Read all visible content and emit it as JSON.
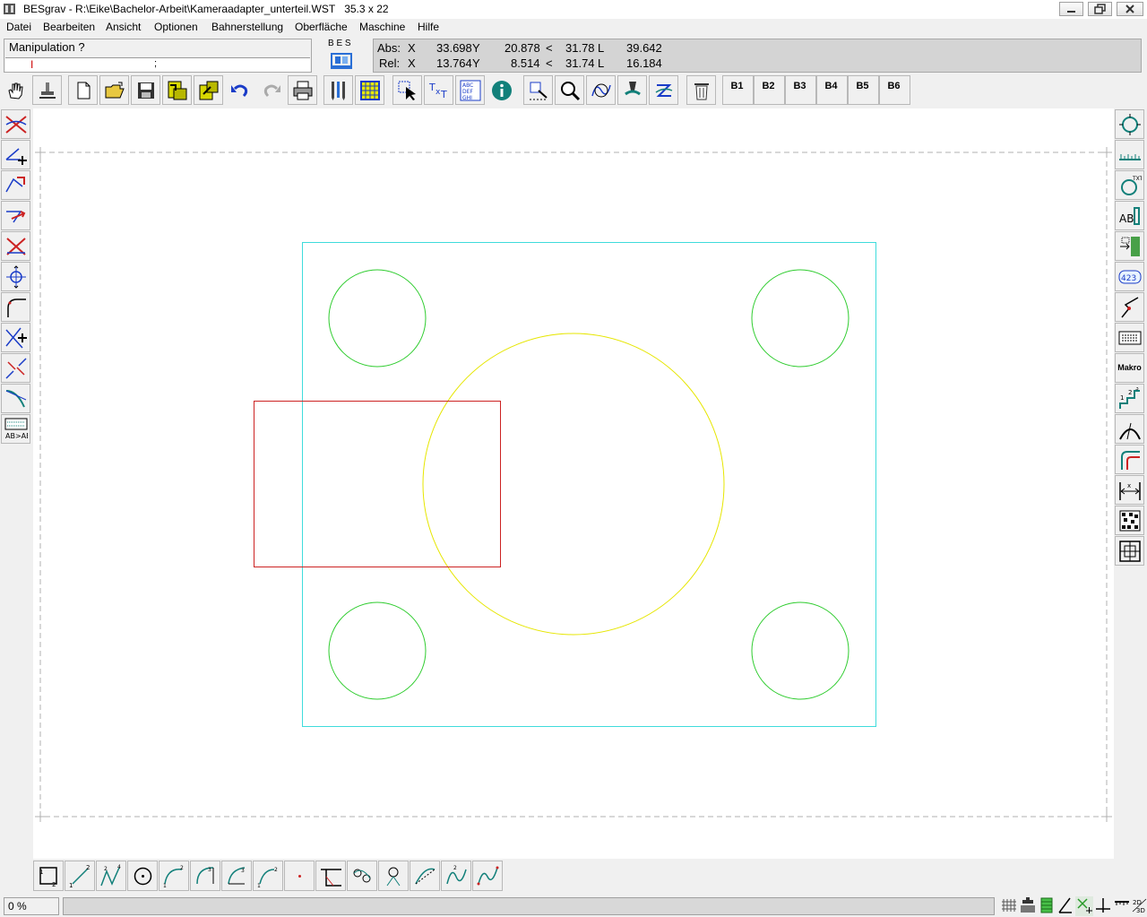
{
  "window": {
    "app_name": "BESgrav",
    "separator": " - ",
    "file_path": "R:\\Eike\\Bachelor-Arbeit\\Kameraadapter_unterteil.WST",
    "dimensions": "35.3 x 22"
  },
  "menu": [
    "Datei",
    "Bearbeiten",
    "Ansicht",
    "Optionen",
    "Bahnerstellung",
    "Oberfläche",
    "Maschine",
    "Hilfe"
  ],
  "manipulation": {
    "label": "Manipulation ?",
    "input_value": "",
    "semicolon": ";"
  },
  "logo": {
    "text": "B E S"
  },
  "coords": {
    "abs": {
      "label": "Abs:",
      "x_label": "X",
      "x": "33.698",
      "y_label": "Y",
      "y": "20.878",
      "angle_label": "<",
      "angle": "31.78",
      "l_label": "L",
      "l": "39.642"
    },
    "rel": {
      "label": "Rel:",
      "x_label": "X",
      "x": "13.764",
      "y_label": "Y",
      "y": "8.514",
      "angle_label": "<",
      "angle": "31.74",
      "l_label": "L",
      "l": "16.184"
    }
  },
  "toolbar": {
    "b_buttons": [
      "B1",
      "B2",
      "B3",
      "B4",
      "B5",
      "B6"
    ]
  },
  "right_tools": {
    "makro_label": "Makro"
  },
  "status": {
    "percent": "0 %",
    "progress": 0
  },
  "colors": {
    "workpiece": "#3fdcdc",
    "holes": "#2ecc2e",
    "center_circle": "#e6e600",
    "selection": "#cc2222",
    "border_dash": "#b0b0b0"
  }
}
